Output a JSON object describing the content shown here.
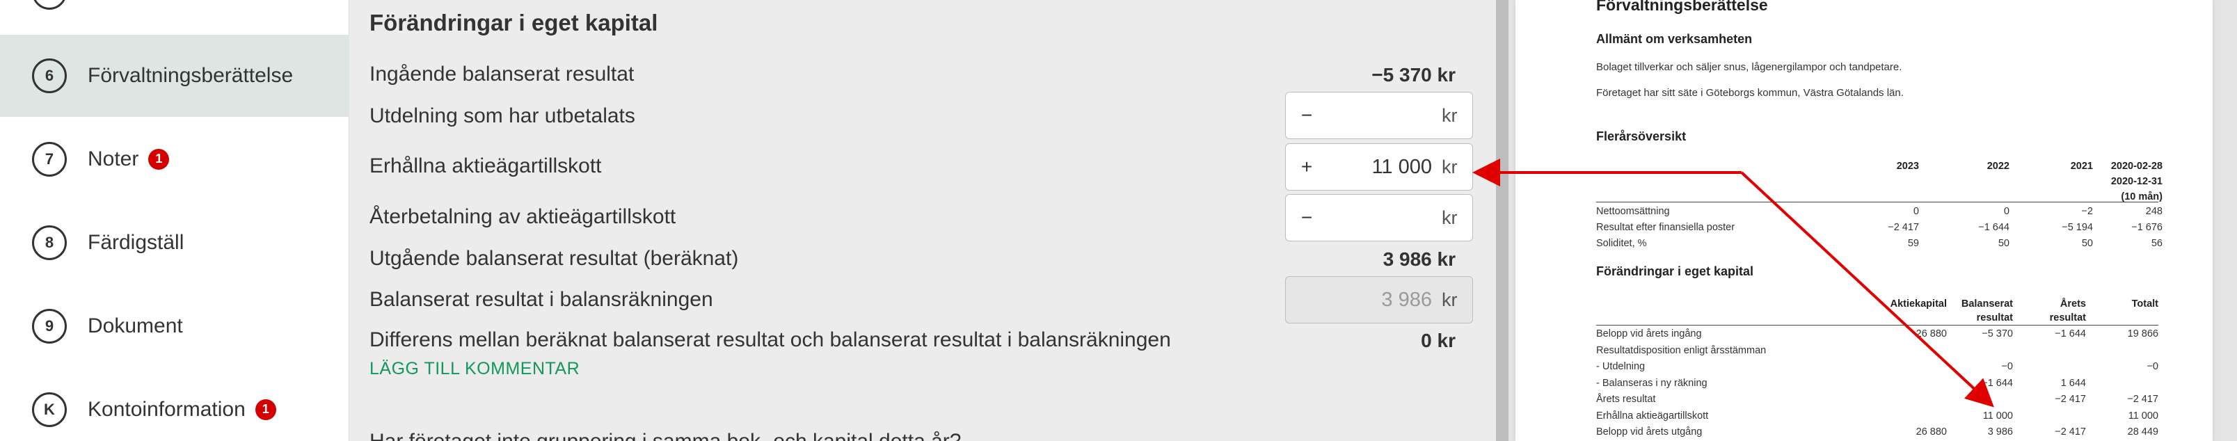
{
  "sidebar": {
    "items": [
      {
        "num": "",
        "label": "",
        "badge": ""
      },
      {
        "num": "6",
        "label": "Förvaltningsberättelse",
        "badge": ""
      },
      {
        "num": "7",
        "label": "Noter",
        "badge": "1"
      },
      {
        "num": "8",
        "label": "Färdigställ",
        "badge": ""
      },
      {
        "num": "9",
        "label": "Dokument",
        "badge": ""
      },
      {
        "num": "K",
        "label": "Kontoinformation",
        "badge": "1"
      }
    ]
  },
  "form": {
    "title": "Förändringar i eget kapital",
    "rows": {
      "ingaende": {
        "label": "Ingående balanserat resultat",
        "value": "−5 370 kr"
      },
      "utdelning": {
        "label": "Utdelning som har utbetalats",
        "sign": "−",
        "value": "",
        "unit": "kr"
      },
      "erhallna": {
        "label": "Erhållna aktieägartillskott",
        "sign": "+",
        "value": "11 000",
        "unit": "kr"
      },
      "aterbetalning": {
        "label": "Återbetalning av aktieägartillskott",
        "sign": "−",
        "value": "",
        "unit": "kr"
      },
      "utgaende": {
        "label": "Utgående balanserat resultat (beräknat)",
        "value": "3 986 kr"
      },
      "balansrakning": {
        "label": "Balanserat resultat i balansräkningen",
        "value": "3 986",
        "unit": "kr"
      },
      "differens": {
        "label": "Differens mellan beräknat balanserat resultat och balanserat resultat i balansräkningen",
        "value": "0 kr"
      }
    },
    "comment_link": "LÄGG TILL KOMMENTAR",
    "cut_text": "Har företaget inte gruppering i samma bok- och kapital detta år?"
  },
  "doc": {
    "title": "Förvaltningsberättelse",
    "section_general": "Allmänt om verksamheten",
    "general_p1": "Bolaget tillverkar och säljer snus, lågenergilampor och tandpetare.",
    "general_p2": "Företaget har sitt säte i Göteborgs kommun, Västra Götalands län.",
    "section_multi": "Flerårsöversikt",
    "multi_headers": [
      "2023",
      "2022",
      "2021",
      "2020-02-28",
      "2020-12-31",
      "(10 mån)"
    ],
    "multi_rows": [
      {
        "label": "Nettoomsättning",
        "v": [
          "0",
          "0",
          "−2",
          "248"
        ]
      },
      {
        "label": "Resultat efter finansiella poster",
        "v": [
          "−2 417",
          "−1 644",
          "−5 194",
          "−1 676"
        ]
      },
      {
        "label": "Soliditet, %",
        "v": [
          "59",
          "50",
          "50",
          "56"
        ]
      }
    ],
    "section_equity": "Förändringar i eget kapital",
    "equity_headers": {
      "c1": "Aktiekapital",
      "c2a": "Balanserat",
      "c2b": "resultat",
      "c3a": "Årets",
      "c3b": "resultat",
      "c4": "Totalt"
    },
    "equity_rows": [
      {
        "label": "Belopp vid årets ingång",
        "v": [
          "26 880",
          "−5 370",
          "−1 644",
          "19 866"
        ]
      },
      {
        "label": "Resultatdisposition enligt årsstämman",
        "v": [
          "",
          "",
          "",
          ""
        ]
      },
      {
        "label": "- Utdelning",
        "v": [
          "",
          "−0",
          "",
          "−0"
        ]
      },
      {
        "label": "- Balanseras i ny räkning",
        "v": [
          "",
          "−1 644",
          "1 644",
          ""
        ]
      },
      {
        "label": "Årets resultat",
        "v": [
          "",
          "",
          "−2 417",
          "−2 417"
        ]
      },
      {
        "label": "Erhållna aktieägartillskott",
        "v": [
          "",
          "11 000",
          "",
          "11 000"
        ]
      },
      {
        "label": "Belopp vid årets utgång",
        "v": [
          "26 880",
          "3 986",
          "−2 417",
          "28 449"
        ]
      }
    ]
  },
  "colors": {
    "accent_green": "#12975c",
    "badge_red": "#d40000",
    "arrow_red": "#e00000",
    "active_bg": "#dde6e2"
  }
}
